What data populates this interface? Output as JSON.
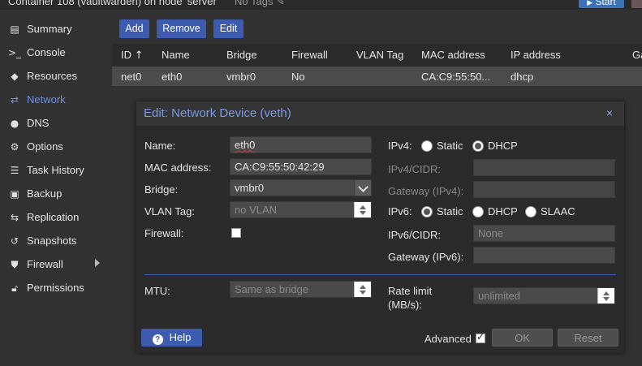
{
  "topbar": {
    "title": "Container 108 (vaultwarden) on node 'server'",
    "tags": "No Tags",
    "start_label": "Start"
  },
  "sidebar": {
    "items": [
      {
        "label": "Summary",
        "icon": "book-icon"
      },
      {
        "label": "Console",
        "icon": "terminal-icon"
      },
      {
        "label": "Resources",
        "icon": "cube-icon"
      },
      {
        "label": "Network",
        "icon": "exchange-icon"
      },
      {
        "label": "DNS",
        "icon": "globe-icon"
      },
      {
        "label": "Options",
        "icon": "gear-icon"
      },
      {
        "label": "Task History",
        "icon": "list-icon"
      },
      {
        "label": "Backup",
        "icon": "floppy-icon"
      },
      {
        "label": "Replication",
        "icon": "retweet-icon"
      },
      {
        "label": "Snapshots",
        "icon": "history-icon"
      },
      {
        "label": "Firewall",
        "icon": "shield-icon"
      },
      {
        "label": "Permissions",
        "icon": "unlock-icon"
      }
    ],
    "active": "Network"
  },
  "toolbar": {
    "add_label": "Add",
    "remove_label": "Remove",
    "edit_label": "Edit"
  },
  "grid": {
    "columns": [
      "ID",
      "Name",
      "Bridge",
      "Firewall",
      "VLAN Tag",
      "MAC address",
      "IP address",
      "Ga"
    ],
    "sort_indicator": "↑",
    "rows": [
      {
        "id": "net0",
        "name": "eth0",
        "bridge": "vmbr0",
        "firewall": "No",
        "vlan": "",
        "mac": "CA:C9:55:50...",
        "ip": "dhcp"
      }
    ]
  },
  "dialog": {
    "title": "Edit: Network Device (veth)",
    "close_glyph": "×",
    "left": {
      "name_label": "Name:",
      "name_value": "eth0",
      "mac_label": "MAC address:",
      "mac_value": "CA:C9:55:50:42:29",
      "bridge_label": "Bridge:",
      "bridge_value": "vmbr0",
      "vlan_label": "VLAN Tag:",
      "vlan_placeholder": "no VLAN",
      "firewall_label": "Firewall:",
      "firewall_checked": false,
      "mtu_label": "MTU:",
      "mtu_placeholder": "Same as bridge"
    },
    "right": {
      "ipv4_label": "IPv4:",
      "ipv4_options": [
        "Static",
        "DHCP"
      ],
      "ipv4_selected": "DHCP",
      "ipv4cidr_label": "IPv4/CIDR:",
      "gateway4_label": "Gateway (IPv4):",
      "ipv6_label": "IPv6:",
      "ipv6_options": [
        "Static",
        "DHCP",
        "SLAAC"
      ],
      "ipv6_selected": "Static",
      "ipv6cidr_label": "IPv6/CIDR:",
      "ipv6cidr_placeholder": "None",
      "gateway6_label": "Gateway (IPv6):",
      "rate_label_1": "Rate limit",
      "rate_label_2": "(MB/s):",
      "rate_placeholder": "unlimited"
    },
    "footer": {
      "help_label": "Help",
      "advanced_label": "Advanced",
      "advanced_checked": true,
      "ok_label": "OK",
      "reset_label": "Reset"
    }
  },
  "colors": {
    "accent": "#3d5cb0",
    "title_blue": "#7d9be0",
    "active_nav": "#6f8fd8"
  }
}
